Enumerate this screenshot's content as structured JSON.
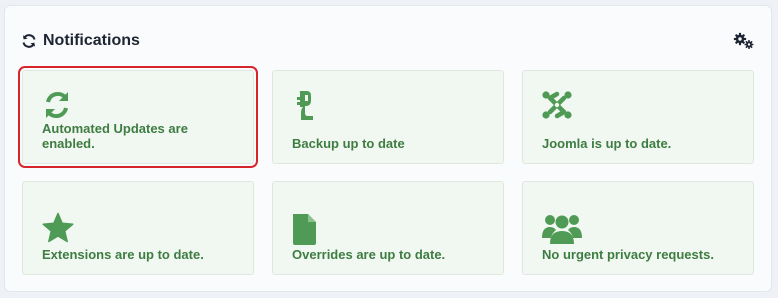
{
  "panel": {
    "title": "Notifications",
    "refresh_icon": "refresh-icon",
    "settings_icon": "gears-icon"
  },
  "cards": [
    {
      "label": "Automated Updates are enabled.",
      "icon": "sync-icon",
      "selected": true
    },
    {
      "label": "Backup up to date",
      "icon": "backup-icon"
    },
    {
      "label": "Joomla is up to date.",
      "icon": "joomla-icon"
    },
    {
      "label": "Extensions are up to date.",
      "icon": "star-icon"
    },
    {
      "label": "Overrides are up to date.",
      "icon": "file-icon"
    },
    {
      "label": "No urgent privacy requests.",
      "icon": "users-icon"
    }
  ],
  "colors": {
    "accent_green": "#3e7d42",
    "icon_green": "#4f9b55",
    "card_bg": "#f1f7f1",
    "selection_red": "#d6262b"
  }
}
